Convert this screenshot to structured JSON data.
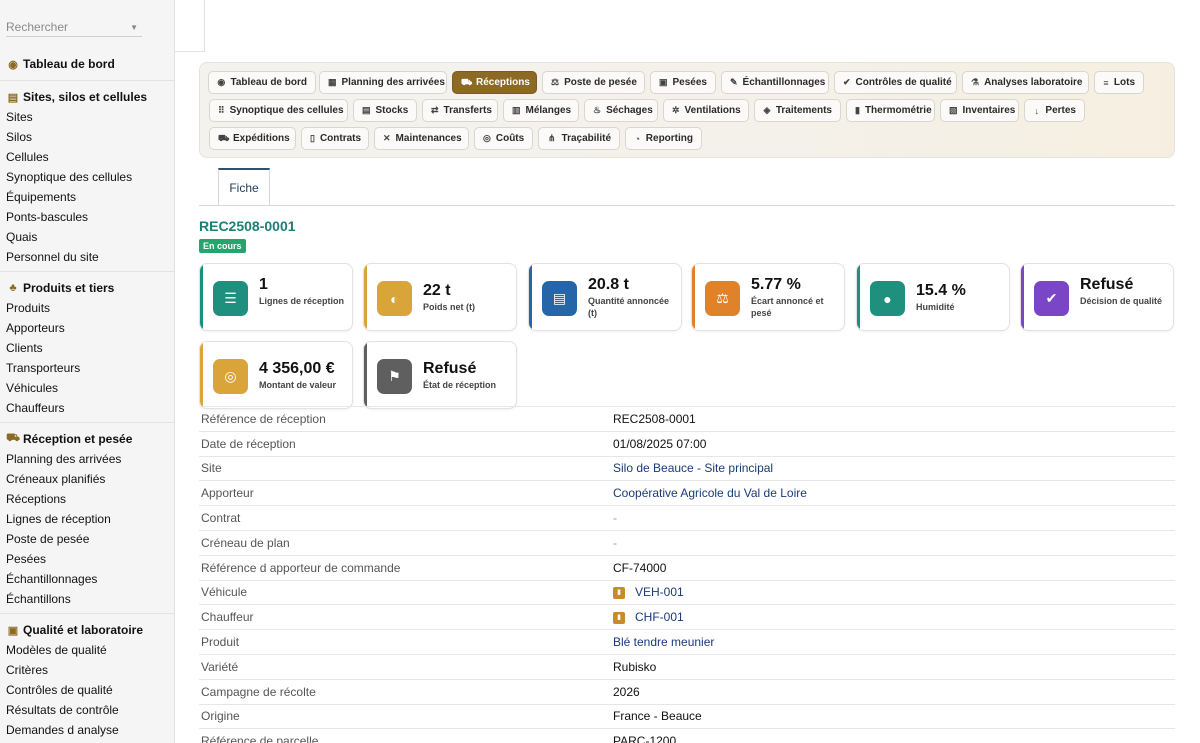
{
  "search": {
    "placeholder": "Rechercher"
  },
  "sidebar": {
    "dashboard": "Tableau de bord",
    "sections": [
      {
        "title": "Sites, silos et cellules",
        "icon": "silo-icon",
        "items": [
          "Sites",
          "Silos",
          "Cellules",
          "Synoptique des cellules",
          "Équipements",
          "Ponts-bascules",
          "Quais",
          "Personnel du site"
        ]
      },
      {
        "title": "Produits et tiers",
        "icon": "sprout-icon",
        "items": [
          "Produits",
          "Apporteurs",
          "Clients",
          "Transporteurs",
          "Véhicules",
          "Chauffeurs"
        ]
      },
      {
        "title": "Réception et pesée",
        "icon": "truck-icon",
        "items": [
          "Planning des arrivées",
          "Créneaux planifiés",
          "Réceptions",
          "Lignes de réception",
          "Poste de pesée",
          "Pesées",
          "Échantillonnages",
          "Échantillons"
        ]
      },
      {
        "title": "Qualité et laboratoire",
        "icon": "clipboard-check-icon",
        "items": [
          "Modèles de qualité",
          "Critères",
          "Contrôles de qualité",
          "Résultats de contrôle",
          "Demandes d analyse"
        ]
      }
    ]
  },
  "top_nav": [
    {
      "label": "Tableau de bord",
      "icon": "gauge-icon",
      "glyph": "◉"
    },
    {
      "label": "Planning des arrivées",
      "icon": "calendar-icon",
      "glyph": "▦"
    },
    {
      "label": "Réceptions",
      "icon": "truck-icon",
      "glyph": "⛟",
      "active": true
    },
    {
      "label": "Poste de pesée",
      "icon": "scale-icon",
      "glyph": "⚖"
    },
    {
      "label": "Pesées",
      "icon": "weight-icon",
      "glyph": "▣"
    },
    {
      "label": "Échantillonnages",
      "icon": "eyedropper-icon",
      "glyph": "✎"
    },
    {
      "label": "Contrôles de qualité",
      "icon": "check-circle-icon",
      "glyph": "✔"
    },
    {
      "label": "Analyses laboratoire",
      "icon": "microscope-icon",
      "glyph": "⚗"
    },
    {
      "label": "Lots",
      "icon": "layers-icon",
      "glyph": "≡"
    },
    {
      "label": "Synoptique des cellules",
      "icon": "grid-icon",
      "glyph": "⠿"
    },
    {
      "label": "Stocks",
      "icon": "boxes-icon",
      "glyph": "▤"
    },
    {
      "label": "Transferts",
      "icon": "shuffle-icon",
      "glyph": "⇄"
    },
    {
      "label": "Mélanges",
      "icon": "blender-icon",
      "glyph": "▥"
    },
    {
      "label": "Séchages",
      "icon": "flame-icon",
      "glyph": "♨"
    },
    {
      "label": "Ventilations",
      "icon": "fan-icon",
      "glyph": "✲"
    },
    {
      "label": "Traitements",
      "icon": "shield-icon",
      "glyph": "◈"
    },
    {
      "label": "Thermométrie",
      "icon": "thermometer-icon",
      "glyph": "▮"
    },
    {
      "label": "Inventaires",
      "icon": "clipboard-icon",
      "glyph": "▧"
    },
    {
      "label": "Pertes",
      "icon": "arrow-down-icon",
      "glyph": "↓"
    },
    {
      "label": "Expéditions",
      "icon": "truck-shipping-icon",
      "glyph": "⛟"
    },
    {
      "label": "Contrats",
      "icon": "file-icon",
      "glyph": "▯"
    },
    {
      "label": "Maintenances",
      "icon": "tools-icon",
      "glyph": "✕"
    },
    {
      "label": "Coûts",
      "icon": "coins-icon",
      "glyph": "◎"
    },
    {
      "label": "Traçabilité",
      "icon": "network-icon",
      "glyph": "⋔"
    },
    {
      "label": "Reporting",
      "icon": "pie-chart-icon",
      "glyph": "◔"
    }
  ],
  "tabs": {
    "fiche": "Fiche"
  },
  "record": {
    "title": "REC2508-0001",
    "status": "En cours"
  },
  "kpis": [
    {
      "value": "1",
      "label": "Lignes de réception",
      "icon": "list-icon",
      "glyph": "☰",
      "color": "#1f8f7e",
      "bar": "#1f8f7e"
    },
    {
      "value": "22 t",
      "label": "Poids net (t)",
      "icon": "scale-weight-icon",
      "glyph": "◐",
      "color": "#d9a53a",
      "bar": "#d9a53a"
    },
    {
      "value": "20.8 t",
      "label": "Quantité annoncée (t)",
      "icon": "clipboard-list-icon",
      "glyph": "▤",
      "color": "#2466a8",
      "bar": "#2466a8"
    },
    {
      "value": "5.77 %",
      "label": "Écart annoncé et pesé",
      "icon": "balance-icon",
      "glyph": "⚖",
      "color": "#e0822a",
      "bar": "#e0822a"
    },
    {
      "value": "15.4 %",
      "label": "Humidité",
      "icon": "droplet-icon",
      "glyph": "●",
      "color": "#1f8f7e",
      "bar": "#1f8f7e"
    },
    {
      "value": "Refusé",
      "label": "Décision de qualité",
      "icon": "check-badge-icon",
      "glyph": "✔",
      "color": "#7b46c6",
      "bar": "#7b46c6"
    },
    {
      "value": "4 356,00 €",
      "label": "Montant de valeur",
      "icon": "coins-icon",
      "glyph": "◎",
      "color": "#d9a53a",
      "bar": "#d9a53a"
    },
    {
      "value": "Refusé",
      "label": "État de réception",
      "icon": "flag-icon",
      "glyph": "⚑",
      "color": "#5f5f5f",
      "bar": "#5f5f5f"
    }
  ],
  "details": [
    {
      "key": "Référence de réception",
      "value": "REC2508-0001",
      "type": "text"
    },
    {
      "key": "Date de réception",
      "value": "01/08/2025 07:00",
      "type": "text"
    },
    {
      "key": "Site",
      "value": "Silo de Beauce - Site principal",
      "type": "link"
    },
    {
      "key": "Apporteur",
      "value": "Coopérative Agricole du Val de Loire",
      "type": "link"
    },
    {
      "key": "Contrat",
      "value": "-",
      "type": "dash"
    },
    {
      "key": "Créneau de plan",
      "value": "-",
      "type": "dash"
    },
    {
      "key": "Référence d apporteur de commande",
      "value": "CF-74000",
      "type": "text"
    },
    {
      "key": "Véhicule",
      "value": "VEH-001",
      "type": "chip"
    },
    {
      "key": "Chauffeur",
      "value": "CHF-001",
      "type": "chip"
    },
    {
      "key": "Produit",
      "value": "Blé tendre meunier",
      "type": "link"
    },
    {
      "key": "Variété",
      "value": "Rubisko",
      "type": "text"
    },
    {
      "key": "Campagne de récolte",
      "value": "2026",
      "type": "text"
    },
    {
      "key": "Origine",
      "value": "France - Beauce",
      "type": "text"
    },
    {
      "key": "Référence de parcelle",
      "value": "PARC-1200",
      "type": "text"
    }
  ]
}
